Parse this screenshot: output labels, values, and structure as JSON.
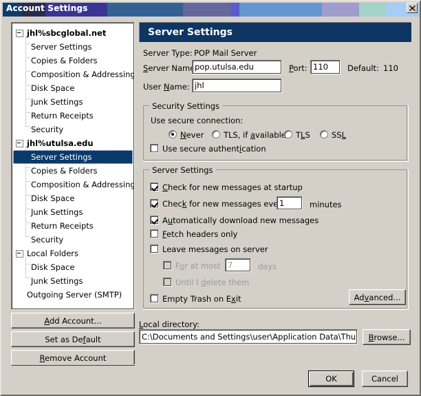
{
  "window": {
    "title": "Account Settings",
    "close_icon": "close-icon",
    "title_bands": [
      "#0d3d6b",
      "#2b2a4e",
      "#383594",
      "#346193",
      "#66679a",
      "#5a5ad2",
      "#6596cf",
      "#a09ccd",
      "#a2d3c9",
      "#a5cdf5"
    ]
  },
  "sidebar": {
    "accounts": [
      {
        "name": "jhl%sbcglobal.net",
        "expanded": true,
        "children": [
          "Server Settings",
          "Copies & Folders",
          "Composition & Addressing",
          "Disk Space",
          "Junk Settings",
          "Return Receipts",
          "Security"
        ]
      },
      {
        "name": "jhl%utulsa.edu",
        "expanded": true,
        "children": [
          "Server Settings",
          "Copies & Folders",
          "Composition & Addressing",
          "Disk Space",
          "Junk Settings",
          "Return Receipts",
          "Security"
        ]
      },
      {
        "name": "Local Folders",
        "expanded": true,
        "children": [
          "Disk Space",
          "Junk Settings"
        ]
      }
    ],
    "outgoing_server": "Outgoing Server (SMTP)",
    "selected_item": "Server Settings",
    "selection_color": "#0a3a6b",
    "buttons": {
      "add_account": "Add Account...",
      "set_as_default": "Set as Default",
      "remove_account": "Remove Account"
    }
  },
  "main": {
    "header": "Server Settings",
    "header_color": "#0d3665",
    "server_type_label": "Server Type:",
    "server_type_value": "POP Mail Server",
    "server_name_label": "Server Name:",
    "server_name_value": "pop.utulsa.edu",
    "port_label": "Port:",
    "port_value": "110",
    "default_label": "Default:",
    "default_value": "110",
    "user_name_label": "User Name:",
    "user_name_value": "jhl",
    "security_group": {
      "title": "Security Settings",
      "use_secure_connection_label": "Use secure connection:",
      "radios": [
        {
          "label": "Never",
          "checked": true
        },
        {
          "label": "TLS, if available",
          "checked": false
        },
        {
          "label": "TLS",
          "checked": false
        },
        {
          "label": "SSL",
          "checked": false
        }
      ],
      "secure_auth_label": "Use secure authentication",
      "secure_auth_checked": false
    },
    "server_group": {
      "title": "Server Settings",
      "check_startup_label": "Check for new messages at startup",
      "check_startup_checked": true,
      "check_every_label": "Check for new messages every",
      "check_every_checked": true,
      "check_every_value": "1",
      "minutes_label": "minutes",
      "auto_download_label": "Automatically download new messages",
      "auto_download_checked": true,
      "fetch_headers_label": "Fetch headers only",
      "fetch_headers_checked": false,
      "leave_messages_label": "Leave messages on server",
      "leave_messages_checked": false,
      "for_at_most_label": "For at most",
      "for_at_most_checked": false,
      "for_at_most_value": "7",
      "days_label": "days",
      "until_delete_label": "Until I delete them",
      "until_delete_checked": false,
      "empty_trash_label": "Empty Trash on Exit",
      "empty_trash_checked": false,
      "advanced_button": "Advanced..."
    },
    "local_directory_label": "Local directory:",
    "local_directory_value": "C:\\Documents and Settings\\user\\Application Data\\Thunderbird\\",
    "browse_button": "Browse..."
  },
  "footer": {
    "ok_button": "OK",
    "cancel_button": "Cancel"
  }
}
